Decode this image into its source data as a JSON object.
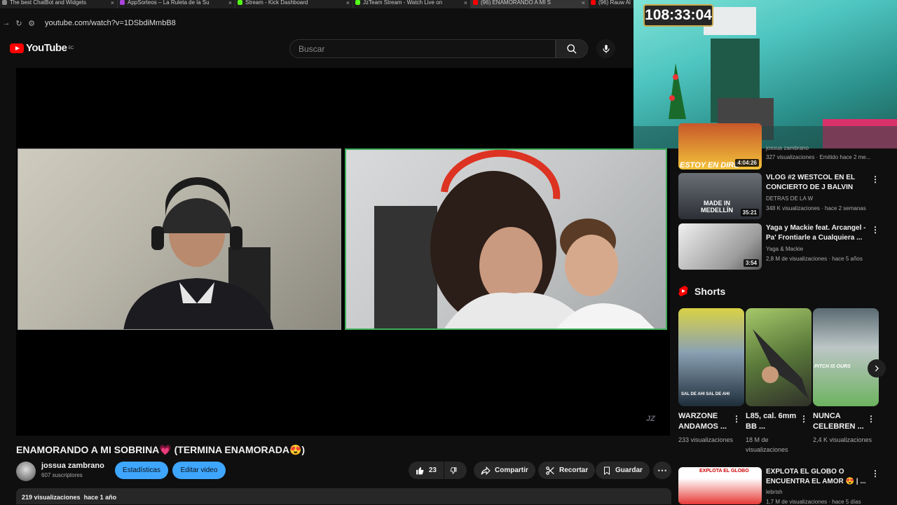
{
  "tabs": [
    {
      "label": "The best ChatBot and Widgets",
      "color": "#888888"
    },
    {
      "label": "AppSorteos – La Ruleta de la Su",
      "color": "#aa44dd"
    },
    {
      "label": "Stream - Kick Dashboard",
      "color": "#53fc18"
    },
    {
      "label": "JzTeam Stream - Watch Live on",
      "color": "#53fc18"
    },
    {
      "label": "(96) ENAMORANDO A MI S",
      "color": "#ff0000"
    },
    {
      "label": "(96) Rauw Al",
      "color": "#ff0000"
    }
  ],
  "address": {
    "url": "youtube.com/watch?v=1DSbdiMmbB8"
  },
  "header": {
    "logo": "YouTube",
    "region": "EC",
    "search_placeholder": "Buscar"
  },
  "overlay": {
    "timer": "108:33:04"
  },
  "player": {
    "watermark": "JZ"
  },
  "video": {
    "title": "ENAMORANDO A MI SOBRINA💗 (TERMINA ENAMORADA😍)",
    "channel": "jossua zambrano",
    "subscribers": "607 suscriptores",
    "btn_stats": "Estadísticas",
    "btn_edit": "Editar video",
    "likes": "23",
    "share": "Compartir",
    "clip": "Recortar",
    "save": "Guardar",
    "views": "219 visualizaciones",
    "age": "hace 1 año"
  },
  "sidebar": {
    "top_partial": {
      "channel": "jossua zambrano",
      "meta": "327 visualizaciones · Emitido hace 2 me...",
      "duration": "4:04:26",
      "thumb_text": "ESTOY EN DIRE"
    },
    "videos": [
      {
        "title": "VLOG #2 WESTCOL EN EL CONCIERTO DE J BALVIN",
        "channel": "DETRAS DE LA W",
        "meta": "348 K visualizaciones · hace 2 semanas",
        "duration": "35:21",
        "thumb_text": "MADE IN MEDELLÍN"
      },
      {
        "title": "Yaga y Mackie feat. Arcangel - Pa' Frontiarle a Cualquiera ...",
        "channel": "Yaga & Mackie",
        "meta": "2,8 M de visualizaciones · hace 5 años",
        "duration": "3:54",
        "thumb_text": ""
      }
    ],
    "shorts_label": "Shorts",
    "shorts": [
      {
        "title": "WARZONE ANDAMOS ...",
        "views": "233 visualizaciones",
        "thumb_text": "SAL DE AHI SAL DE AHI"
      },
      {
        "title": "L85, cal. 6mm BB ...",
        "views": "18 M de visualizaciones",
        "thumb_text": ""
      },
      {
        "title": "NUNCA CELEBREN ...",
        "views": "2,4 K visualizaciones",
        "thumb_text": "PITCH IS OURS"
      }
    ],
    "bottom_video": {
      "title": "EXPLOTA EL GLOBO O ENCUENTRA EL AMOR 😍 | ...",
      "channel": "lebrish",
      "meta": "1,7 M de visualizaciones · hace 5 días",
      "thumb_text": "EXPLOTA EL GLOBO"
    }
  }
}
